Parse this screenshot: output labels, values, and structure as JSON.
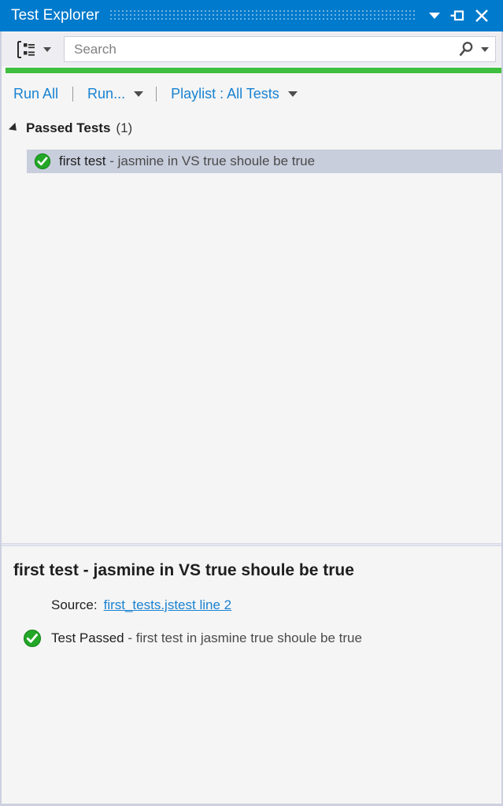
{
  "window": {
    "title": "Test Explorer",
    "accent_color": "#007acc",
    "controls": {
      "dropdown_label": "Window options",
      "pin_label": "Auto Hide",
      "close_label": "Close"
    }
  },
  "toolbar": {
    "group_by_label": "Group By",
    "search": {
      "value": "",
      "placeholder": "Search",
      "icon": "search-icon",
      "dropdown_label": "Search options"
    }
  },
  "status": {
    "progress_color": "#3fbf3f",
    "progress_percent": 100
  },
  "commands": {
    "run_all": "Run All",
    "run": "Run...",
    "playlist": "Playlist : All Tests"
  },
  "test_list": {
    "groups": [
      {
        "name": "Passed Tests",
        "count": "(1)",
        "expanded": true,
        "tests": [
          {
            "name_primary": "first test",
            "name_secondary": " - jasmine in VS true shoule be true",
            "status_icon": "passed-check-icon",
            "selected": true
          }
        ]
      }
    ]
  },
  "detail": {
    "title": "first test - jasmine in VS true shoule be true",
    "source_label": "Source:",
    "source_link": "first_tests.jstest line 2",
    "result_icon": "passed-check-icon",
    "result_primary": "Test Passed",
    "result_secondary": " - first test in jasmine true shoule be true"
  }
}
